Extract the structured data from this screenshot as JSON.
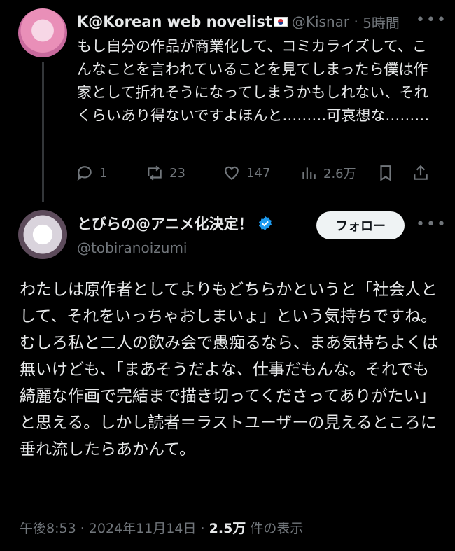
{
  "reply_tweet": {
    "display_name": "K@Korean web novelist",
    "handle": "@Kisnar",
    "time": "5時間",
    "text": "もし自分の作品が商業化して、コミカライズして、こんなことを言われていることを見てしまったら僕は作家として折れそうになってしまうかもしれない、それくらいあり得ないですよほんと………可哀想な………",
    "stats": {
      "replies": "1",
      "reposts": "23",
      "likes": "147",
      "views": "2.6万"
    }
  },
  "main_tweet": {
    "display_name": "とびらの@アニメ化決定！",
    "handle": "@tobiranoizumi",
    "follow_label": "フォロー",
    "text": "わたしは原作者としてよりもどちらかというと「社会人として、それをいっちゃおしまいょ」という気持ちですね。むしろ私と二人の飲み会で愚痴るなら、まあ気持ちよくは無いけども、「まあそうだよな、仕事だもんな。それでも綺麗な作画で完結まで描き切ってくださってありがたい」と思える。しかし読者＝ラストユーザーの見えるところに垂れ流したらあかんて。",
    "timestamp": "午後8:53 · 2024年11月14日 · ",
    "views_count": "2.5万",
    "views_label": " 件の表示"
  },
  "colors": {
    "background": "#000000",
    "text": "#e7e9ea",
    "muted": "#71767b",
    "verified": "#1d9bf0"
  }
}
